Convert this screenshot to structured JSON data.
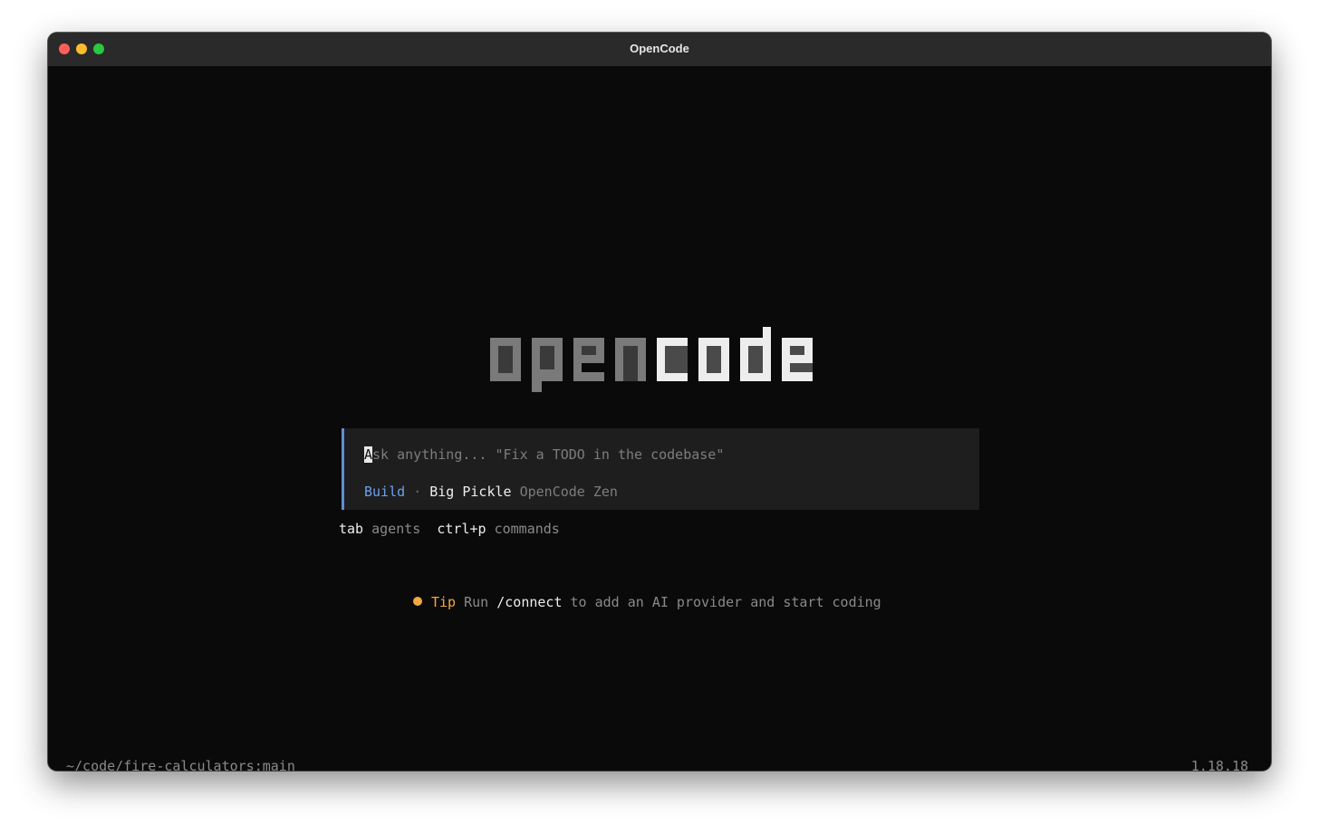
{
  "window": {
    "title": "OpenCode"
  },
  "logo": {
    "text": "opencode",
    "part_dim": "open",
    "part_bright": "code",
    "dim_color": "#7a7a7a",
    "bright_color": "#ededed"
  },
  "prompt": {
    "placeholder_cursor_char": "A",
    "placeholder_rest": "sk anything... \"Fix a TODO in the codebase\"",
    "agent": "Build",
    "separator": "·",
    "model": "Big Pickle",
    "provider": "OpenCode Zen"
  },
  "hints": {
    "key1": "tab",
    "label1": "agents",
    "key2": "ctrl+p",
    "label2": "commands"
  },
  "tip": {
    "label": "Tip",
    "text_before": "Run",
    "command": "/connect",
    "text_after": "to add an AI provider and start coding"
  },
  "status": {
    "path": "~/code/fire-calculators:main",
    "version": "1.18.18"
  },
  "colors": {
    "accent_blue": "#6aa1ee",
    "tip_orange": "#f5a742",
    "background": "#0a0a0a",
    "prompt_bg": "#1e1e1e"
  }
}
